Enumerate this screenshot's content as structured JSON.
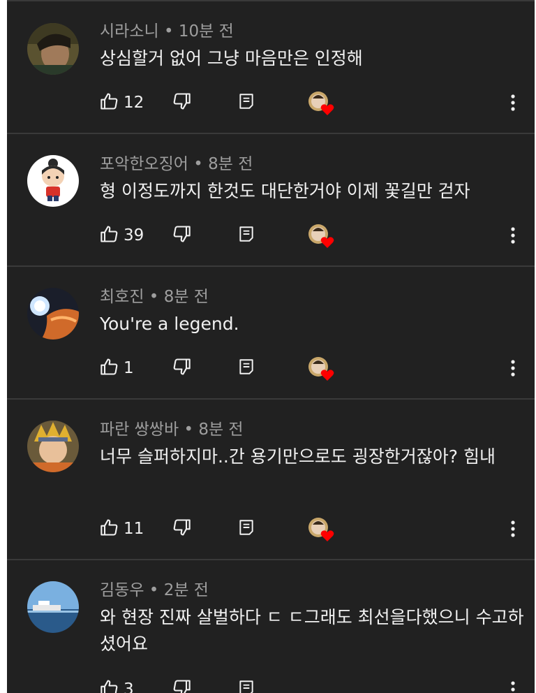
{
  "comments": [
    {
      "author": "시라소니",
      "time": "10분 전",
      "text": "상심할거 없어 그냥 마음만은 인정해",
      "likes": "12"
    },
    {
      "author": "포악한오징어",
      "time": "8분 전",
      "text": "형 이정도까지 한것도 대단한거야 이제 꽃길만 걷자",
      "likes": "39"
    },
    {
      "author": "최호진",
      "time": "8분 전",
      "text": "You're a legend.",
      "likes": "1"
    },
    {
      "author": "파란 쌍쌍바",
      "time": "8분 전",
      "text": "너무 슬퍼하지마..간 용기만으로도 굉장한거잖아? 힘내",
      "likes": "11"
    },
    {
      "author": "김동우",
      "time": "2분 전",
      "text": "와 현장 진짜 살벌하다 ㄷ ㄷ그래도 최선을다했으니 수고하셨어요",
      "likes": "3"
    }
  ],
  "meta_separator": "•",
  "icons": {
    "like": "thumbs-up-icon",
    "dislike": "thumbs-down-icon",
    "reply": "reply-icon",
    "creator_heart": "creator-heart-icon",
    "more": "more-vertical-icon"
  },
  "colors": {
    "background": "#212121",
    "text_primary": "#f1f1f1",
    "text_secondary": "#9e9e9e",
    "divider": "#3a3a3a",
    "heart": "#ff0000"
  }
}
